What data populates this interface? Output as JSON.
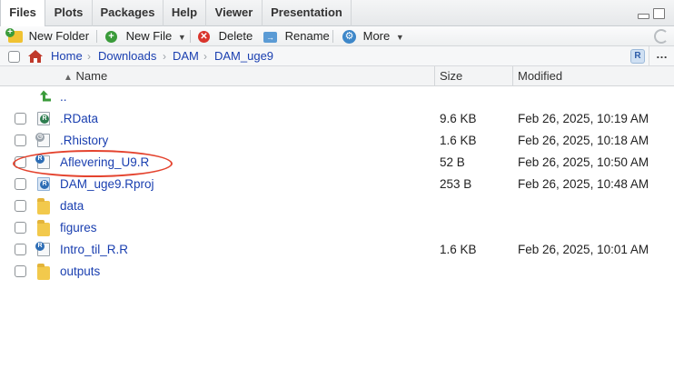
{
  "tabs": [
    {
      "label": "Files",
      "active": true
    },
    {
      "label": "Plots",
      "active": false
    },
    {
      "label": "Packages",
      "active": false
    },
    {
      "label": "Help",
      "active": false
    },
    {
      "label": "Viewer",
      "active": false
    },
    {
      "label": "Presentation",
      "active": false
    }
  ],
  "toolbar": {
    "new_folder": "New Folder",
    "new_file": "New File",
    "delete": "Delete",
    "rename": "Rename",
    "more": "More"
  },
  "breadcrumb": [
    "Home",
    "Downloads",
    "DAM",
    "DAM_uge9"
  ],
  "columns": {
    "name": "Name",
    "size": "Size",
    "modified": "Modified",
    "sort_indicator": "▲"
  },
  "parent_link": "..",
  "files": [
    {
      "name": ".RData",
      "size": "9.6 KB",
      "modified": "Feb 26, 2025, 10:19 AM",
      "icon": "rdata-icon"
    },
    {
      "name": ".Rhistory",
      "size": "1.6 KB",
      "modified": "Feb 26, 2025, 10:18 AM",
      "icon": "rhistory-icon"
    },
    {
      "name": "Aflevering_U9.R",
      "size": "52 B",
      "modified": "Feb 26, 2025, 10:50 AM",
      "icon": "r-script-icon",
      "highlighted": true
    },
    {
      "name": "DAM_uge9.Rproj",
      "size": "253 B",
      "modified": "Feb 26, 2025, 10:48 AM",
      "icon": "rproj-icon"
    },
    {
      "name": "data",
      "size": "",
      "modified": "",
      "icon": "folder-icon"
    },
    {
      "name": "figures",
      "size": "",
      "modified": "",
      "icon": "folder-icon"
    },
    {
      "name": "Intro_til_R.R",
      "size": "1.6 KB",
      "modified": "Feb 26, 2025, 10:01 AM",
      "icon": "r-script-icon"
    },
    {
      "name": "outputs",
      "size": "",
      "modified": "",
      "icon": "folder-icon"
    }
  ],
  "colors": {
    "link": "#1a3fb0",
    "highlight_circle": "#e4432e",
    "folder": "#f2c94c"
  }
}
